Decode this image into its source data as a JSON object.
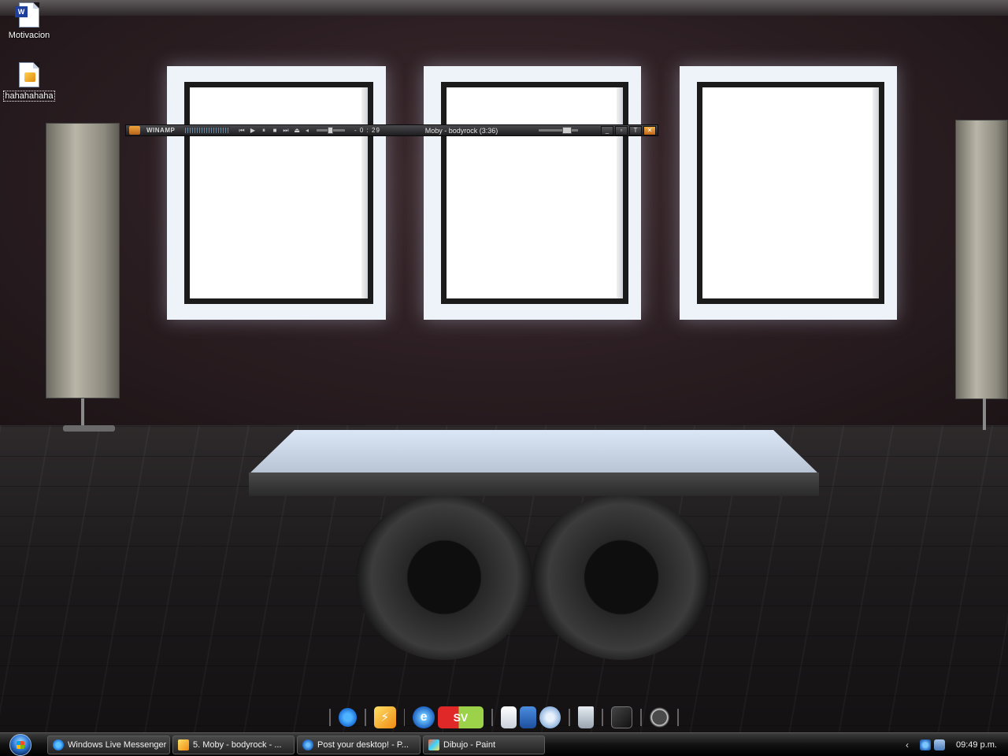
{
  "desktop": {
    "icons": [
      {
        "label": "Motivacion",
        "icon": "word-document-icon"
      },
      {
        "label": "hahahahaha",
        "icon": "audio-file-icon"
      }
    ]
  },
  "winamp": {
    "title": "WINAMP",
    "time": "- 0 : 29",
    "song": "Moby - bodyrock (3:36)",
    "controls": [
      "prev-icon",
      "play-icon",
      "pause-icon",
      "stop-icon",
      "next-icon",
      "eject-icon"
    ],
    "accent": "#f08a12"
  },
  "dock": {
    "icons": [
      "msn-icon",
      "winamp-icon",
      "internet-explorer-icon",
      "sv-app-icon",
      "document-icon",
      "folder-icon",
      "disc-icon",
      "recycle-bin-icon",
      "app-icon",
      "power-icon"
    ],
    "sv_label": "SV"
  },
  "taskbar": {
    "buttons": [
      {
        "label": "Windows Live Messenger",
        "icon": "msn-icon"
      },
      {
        "label": "5. Moby - bodyrock - ...",
        "icon": "winamp-icon"
      },
      {
        "label": "Post your desktop! - P...",
        "icon": "internet-explorer-icon"
      },
      {
        "label": "Dibujo - Paint",
        "icon": "paint-icon"
      }
    ],
    "clock": "09:49 p.m."
  }
}
